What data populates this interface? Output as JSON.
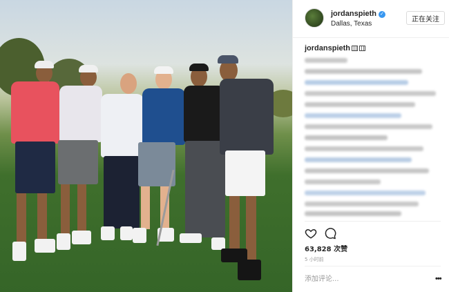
{
  "post": {
    "image_alt": "group-golf-photo"
  },
  "header": {
    "username": "jordanspieth",
    "verified_icon": "verified-badge-icon",
    "location": "Dallas, Texas",
    "follow_label": "正在关注"
  },
  "caption": {
    "username": "jordanspieth"
  },
  "actions": {
    "like_icon": "heart-icon",
    "comment_icon": "comment-bubble-icon",
    "likes_text": "63,828 次赞",
    "time_text": "5 小时前"
  },
  "comment_box": {
    "placeholder": "添加评论...",
    "more_icon": "more-options-icon"
  },
  "colors": {
    "accent": "#3897f0",
    "text": "#262626",
    "muted": "#999999",
    "border": "#efefef"
  }
}
